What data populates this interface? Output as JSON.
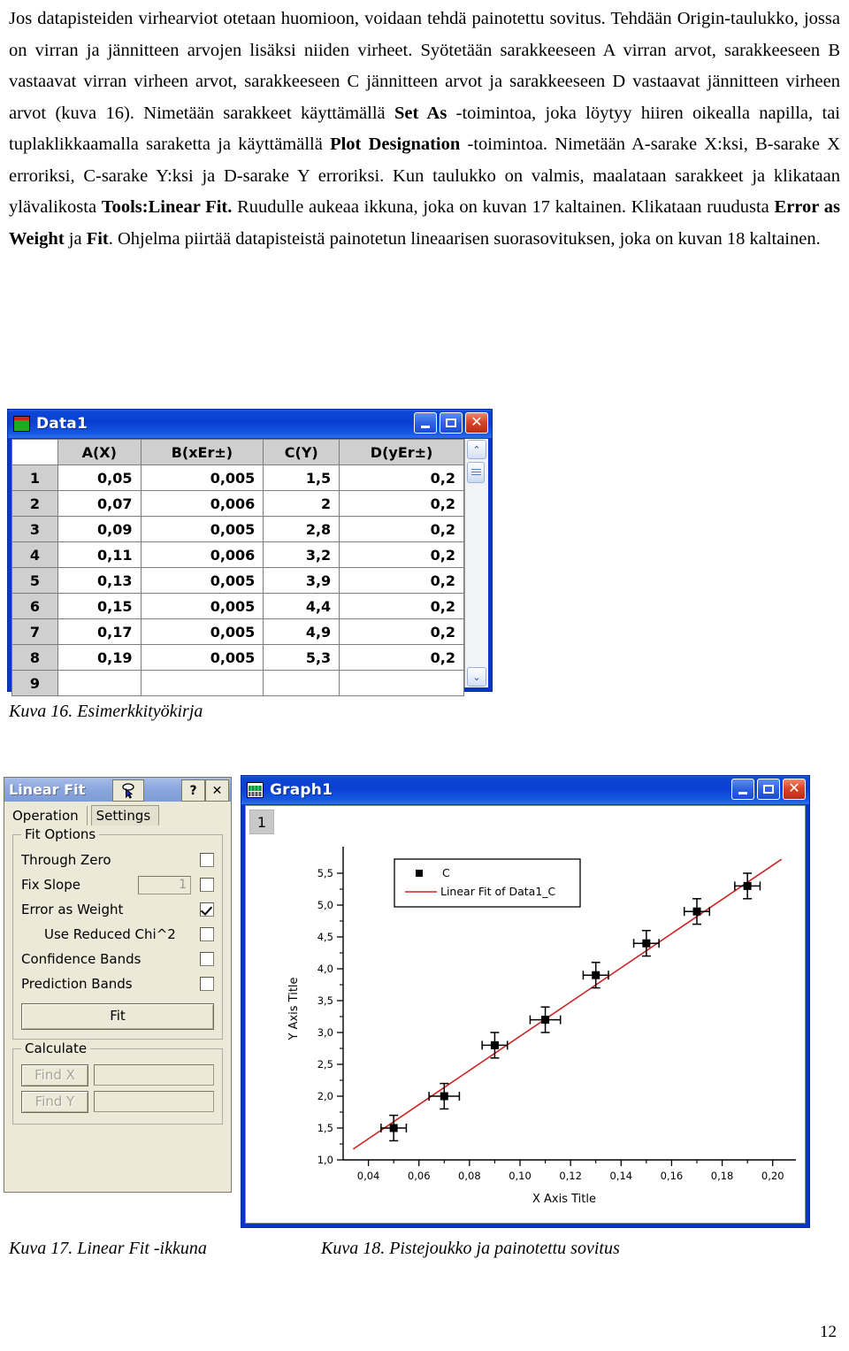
{
  "document": {
    "paragraph_html": "Jos datapisteiden virhearviot otetaan huomioon, voidaan tehdä painotettu sovitus. Tehdään Origin-taulukko, jossa on virran ja jännitteen arvojen lisäksi niiden virheet. Syötetään sarakkeeseen A virran arvot, sarakkeeseen B vastaavat virran virheen arvot, sarakkeeseen C jännitteen arvot ja sarakkeeseen D vastaavat jännitteen virheen arvot (kuva 16). Nimetään sarakkeet käyttämällä <b>Set As</b> -toimintoa, joka löytyy hiiren oikealla napilla, tai tuplaklikkaamalla saraketta ja käyttämällä <b>Plot Designation</b> -toimintoa. Nimetään A-sarake X:ksi, B-sarake X erroriksi, C-sarake Y:ksi ja D-sarake Y erroriksi. Kun taulukko on valmis, maalataan sarakkeet ja klikataan ylävalikosta <b>Tools:Linear Fit.</b> Ruudulle aukeaa ikkuna, joka on kuvan 17 kaltainen. Klikataan ruudusta <b>Error as Weight</b> ja <b>Fit</b>. Ohjelma piirtää datapisteistä painotetun lineaarisen suorasovituksen, joka on kuvan 18 kaltainen.",
    "page_number": "12"
  },
  "captions": {
    "kuva16": "Kuva 16. Esimerkkityökirja",
    "kuva17": "Kuva 17. Linear Fit -ikkuna",
    "kuva18": "Kuva 18. Pistejoukko ja painotettu sovitus"
  },
  "data_window": {
    "title": "Data1",
    "buttons": {
      "minimize": "_",
      "maximize": "□",
      "close": "✕"
    },
    "columns": [
      "",
      "A(X)",
      "B(xEr±)",
      "C(Y)",
      "D(yEr±)"
    ],
    "rows": [
      {
        "n": "1",
        "a": "0,05",
        "b": "0,005",
        "c": "1,5",
        "d": "0,2"
      },
      {
        "n": "2",
        "a": "0,07",
        "b": "0,006",
        "c": "2",
        "d": "0,2"
      },
      {
        "n": "3",
        "a": "0,09",
        "b": "0,005",
        "c": "2,8",
        "d": "0,2"
      },
      {
        "n": "4",
        "a": "0,11",
        "b": "0,006",
        "c": "3,2",
        "d": "0,2"
      },
      {
        "n": "5",
        "a": "0,13",
        "b": "0,005",
        "c": "3,9",
        "d": "0,2"
      },
      {
        "n": "6",
        "a": "0,15",
        "b": "0,005",
        "c": "4,4",
        "d": "0,2"
      },
      {
        "n": "7",
        "a": "0,17",
        "b": "0,005",
        "c": "4,9",
        "d": "0,2"
      },
      {
        "n": "8",
        "a": "0,19",
        "b": "0,005",
        "c": "5,3",
        "d": "0,2"
      },
      {
        "n": "9",
        "a": "",
        "b": "",
        "c": "",
        "d": ""
      }
    ],
    "scrollbar": {
      "up": "⌃",
      "down": "⌄"
    }
  },
  "linear_fit": {
    "title": "Linear Fit",
    "help_label": "?",
    "close_label": "✕",
    "tabs": [
      {
        "label": "Operation",
        "active": true
      },
      {
        "label": "Settings",
        "active": false
      }
    ],
    "fit_options": {
      "group_label": "Fit Options",
      "items": [
        {
          "label": "Through Zero",
          "checked": false,
          "indent": false
        },
        {
          "label": "Fix Slope",
          "checked": false,
          "indent": false,
          "value": "1"
        },
        {
          "label": "Error as Weight",
          "checked": true,
          "indent": false
        },
        {
          "label": "Use Reduced Chi^2",
          "checked": false,
          "indent": true
        },
        {
          "label": "Confidence Bands",
          "checked": false,
          "indent": false
        },
        {
          "label": "Prediction Bands",
          "checked": false,
          "indent": false
        }
      ],
      "fit_button": "Fit"
    },
    "calculate": {
      "group_label": "Calculate",
      "find_x_label": "Find X",
      "find_x_value": "",
      "find_y_label": "Find Y",
      "find_y_value": ""
    }
  },
  "graph_window": {
    "title": "Graph1",
    "layer_label": "1",
    "buttons": {
      "minimize": "_",
      "maximize": "□",
      "close": "✕"
    }
  },
  "chart_data": {
    "type": "scatter",
    "title": "",
    "xlabel": "X Axis Title",
    "ylabel": "Y Axis Title",
    "xlim": [
      0.03,
      0.205
    ],
    "ylim": [
      1.0,
      5.75
    ],
    "xticks": [
      "0,04",
      "0,06",
      "0,08",
      "0,10",
      "0,12",
      "0,14",
      "0,16",
      "0,18",
      "0,20"
    ],
    "xtick_values": [
      0.04,
      0.06,
      0.08,
      0.1,
      0.12,
      0.14,
      0.16,
      0.18,
      0.2
    ],
    "yticks": [
      "1,0",
      "1,5",
      "2,0",
      "2,5",
      "3,0",
      "3,5",
      "4,0",
      "4,5",
      "5,0",
      "5,5"
    ],
    "ytick_values": [
      1.0,
      1.5,
      2.0,
      2.5,
      3.0,
      3.5,
      4.0,
      4.5,
      5.0,
      5.5
    ],
    "grid": false,
    "legend_position": "top-left",
    "legend": [
      {
        "label": "C",
        "marker": "square",
        "color": "#000000"
      },
      {
        "label": "Linear Fit of Data1_C",
        "marker": "line",
        "color": "#cc2222"
      }
    ],
    "series": [
      {
        "name": "C",
        "type": "scatter-errorbars",
        "marker_color": "#000000",
        "x": [
          0.05,
          0.07,
          0.09,
          0.11,
          0.13,
          0.15,
          0.17,
          0.19
        ],
        "y": [
          1.5,
          2.0,
          2.8,
          3.2,
          3.9,
          4.4,
          4.9,
          5.3
        ],
        "xerr": [
          0.005,
          0.006,
          0.005,
          0.006,
          0.005,
          0.005,
          0.005,
          0.005
        ],
        "yerr": [
          0.2,
          0.2,
          0.2,
          0.2,
          0.2,
          0.2,
          0.2,
          0.2
        ]
      },
      {
        "name": "Linear Fit of Data1_C",
        "type": "line",
        "color": "#cc2222",
        "x": [
          0.034,
          0.2035
        ],
        "y": [
          1.17,
          5.72
        ]
      }
    ]
  }
}
